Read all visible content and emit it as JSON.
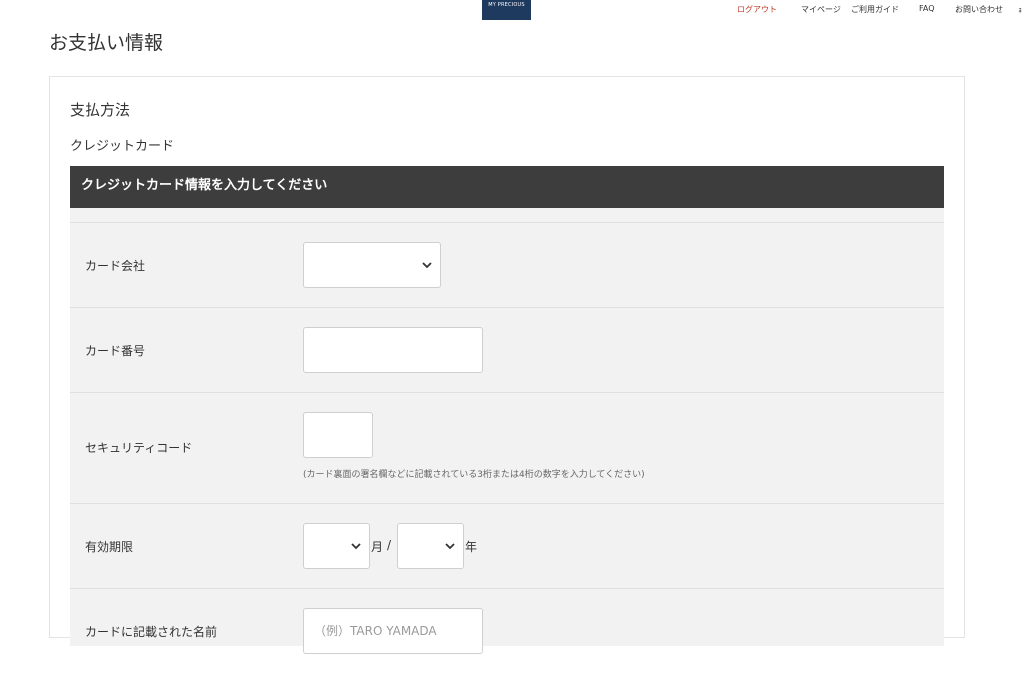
{
  "logo": {
    "text": "MY PRECIOUS"
  },
  "nav": {
    "logout": "ログアウト",
    "mypage": "マイページ",
    "guide": "ご利用ガイド",
    "faq": "FAQ",
    "contact": "お問い合わせ",
    "cut_item": "ｮ"
  },
  "page": {
    "title": "お支払い情報"
  },
  "payment": {
    "heading": "支払方法",
    "method": "クレジットカード",
    "form_header": "クレジットカード情報を入力してください",
    "card_company": {
      "label": "カード会社",
      "value": ""
    },
    "card_number": {
      "label": "カード番号",
      "value": ""
    },
    "security_code": {
      "label": "セキュリティコード",
      "value": "",
      "hint": "(カード裏面の署名欄などに記載されている3桁または4桁の数字を入力してください)"
    },
    "expiry": {
      "label": "有効期限",
      "month_value": "",
      "month_unit": "月",
      "separator": "/",
      "year_value": "",
      "year_unit": "年"
    },
    "card_name": {
      "label": "カードに記載された名前",
      "placeholder": "（例）TARO YAMADA"
    }
  },
  "icons": {
    "select_arrow": "chevron-down-icon"
  }
}
